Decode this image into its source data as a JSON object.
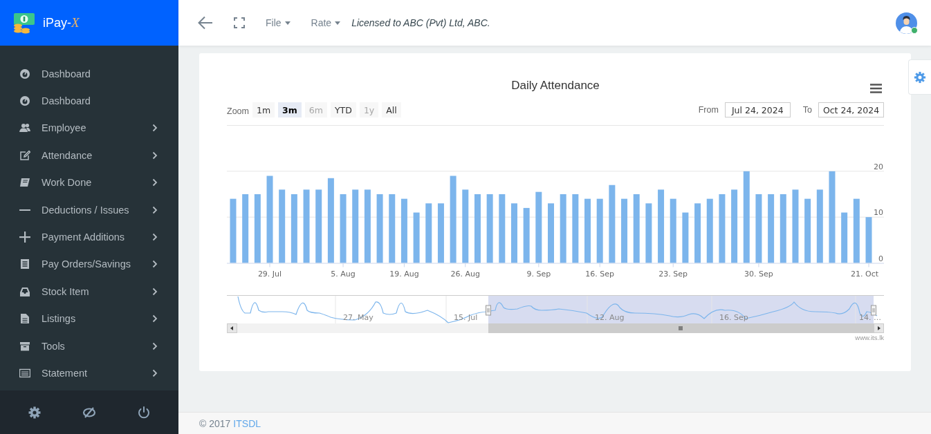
{
  "brand": {
    "name": "iPay-",
    "suffix": "X"
  },
  "topbar": {
    "menus": [
      {
        "label": "File"
      },
      {
        "label": "Rate"
      }
    ],
    "license": "Licensed to ABC (Pvt) Ltd, ABC.",
    "user": {
      "online": true
    }
  },
  "sidebar": {
    "items": [
      {
        "label": "Dashboard",
        "expandable": false
      },
      {
        "label": "Dashboard",
        "expandable": false
      },
      {
        "label": "Employee",
        "expandable": true
      },
      {
        "label": "Attendance",
        "expandable": true
      },
      {
        "label": "Work Done",
        "expandable": true
      },
      {
        "label": "Deductions / Issues",
        "expandable": true
      },
      {
        "label": "Payment Additions",
        "expandable": true
      },
      {
        "label": "Pay Orders/Savings",
        "expandable": true
      },
      {
        "label": "Stock Item",
        "expandable": true
      },
      {
        "label": "Listings",
        "expandable": true
      },
      {
        "label": "Tools",
        "expandable": true
      },
      {
        "label": "Statement",
        "expandable": true
      }
    ]
  },
  "chart": {
    "zoom_label": "Zoom",
    "zoom_buttons": [
      {
        "label": "1m",
        "selected": false,
        "disabled": false
      },
      {
        "label": "3m",
        "selected": true,
        "disabled": false
      },
      {
        "label": "6m",
        "selected": false,
        "disabled": true
      },
      {
        "label": "YTD",
        "selected": false,
        "disabled": false
      },
      {
        "label": "1y",
        "selected": false,
        "disabled": true
      },
      {
        "label": "All",
        "selected": false,
        "disabled": false
      }
    ],
    "from_label": "From",
    "from": "Jul 24, 2024",
    "to_label": "To",
    "to": "Oct 24, 2024",
    "chart_data": {
      "type": "bar",
      "title": "Daily Attendance",
      "categories": [
        null,
        null,
        null,
        "29. Jul",
        null,
        null,
        null,
        null,
        null,
        "5. Aug",
        null,
        null,
        null,
        null,
        "19. Aug",
        null,
        null,
        null,
        null,
        "26. Aug",
        null,
        null,
        null,
        null,
        null,
        "9. Sep",
        null,
        null,
        null,
        null,
        "16. Sep",
        null,
        null,
        null,
        null,
        null,
        "23. Sep",
        null,
        null,
        null,
        null,
        null,
        null,
        "30. Sep",
        null,
        null,
        null,
        null,
        null,
        null,
        null,
        null,
        "21. Oct"
      ],
      "series": [
        {
          "color": "#7cb5ec",
          "values": [
            14,
            15,
            15,
            19,
            16,
            15,
            16,
            16,
            18.5,
            15,
            16,
            16,
            15,
            15,
            14,
            11,
            13,
            13,
            19,
            16,
            15,
            15,
            15,
            13,
            12,
            15.5,
            13,
            15,
            15,
            14,
            14,
            17,
            14,
            15,
            13,
            16,
            14,
            11,
            13,
            14,
            15,
            16,
            20,
            15,
            15,
            15,
            16,
            14,
            16,
            20,
            11,
            14,
            10
          ]
        }
      ],
      "ylim": [
        0,
        30
      ],
      "yticks": [
        0,
        10,
        20
      ]
    },
    "navigator": {
      "labels": [
        "27. May",
        "15. Jul",
        "12. Aug",
        "16. Sep",
        "14. …"
      ]
    },
    "credit": "www.its.lk"
  },
  "footer": {
    "copyright": "© 2017",
    "link": "ITSDL"
  }
}
